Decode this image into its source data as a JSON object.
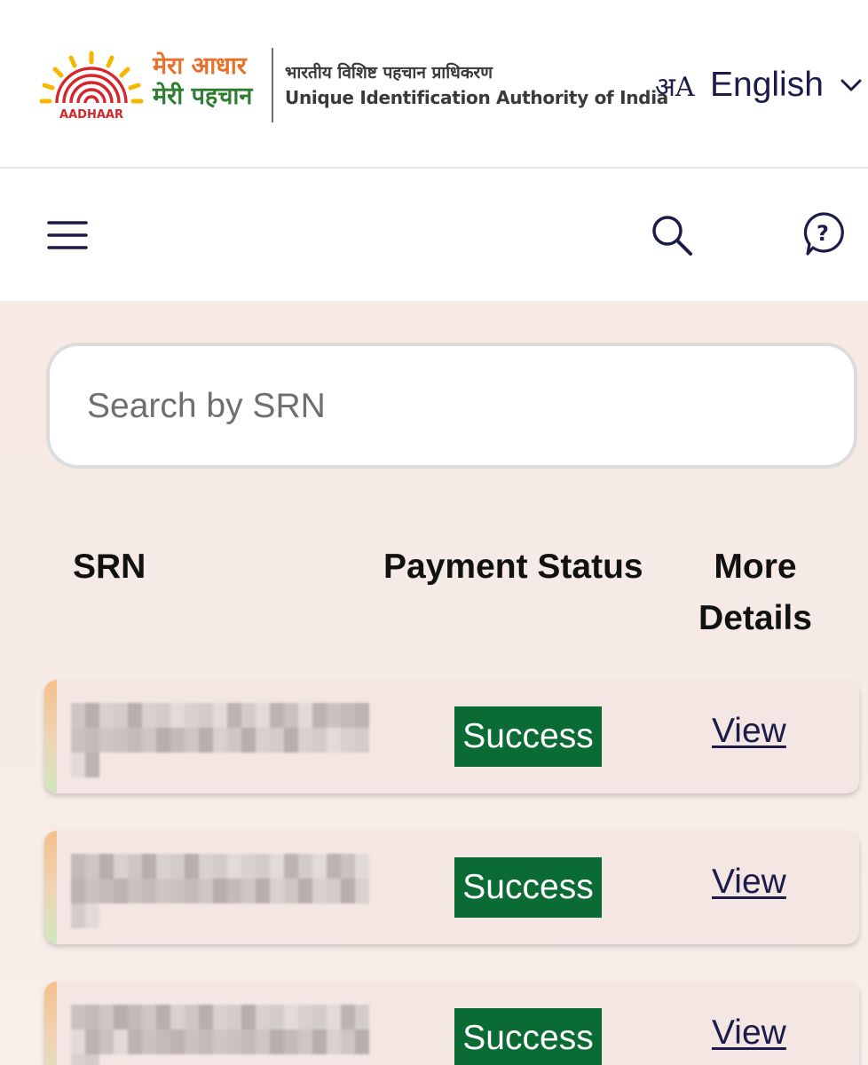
{
  "header": {
    "logo_text": "AADHAAR",
    "tagline_line1": "मेरा आधार",
    "tagline_line2": "मेरी पहचान",
    "org_name_hindi": "भारतीय विशिष्ट पहचान प्राधिकरण",
    "org_name_english": "Unique Identification Authority of India",
    "language_icon_glyph": "अA",
    "language_selected": "English",
    "colors": {
      "saffron": "#e8702a",
      "green": "#2e7d32",
      "navy": "#1c1c4a"
    }
  },
  "navbar": {
    "icons": [
      "menu-icon",
      "search-icon",
      "help-icon"
    ]
  },
  "search": {
    "placeholder": "Search by SRN",
    "value": ""
  },
  "table": {
    "columns": {
      "srn": "SRN",
      "payment_status": "Payment Status",
      "more_details": "More Details"
    },
    "rows": [
      {
        "srn": "",
        "payment_status": "Success",
        "action": "View"
      },
      {
        "srn": "",
        "payment_status": "Success",
        "action": "View"
      },
      {
        "srn": "",
        "payment_status": "Success",
        "action": "View"
      }
    ],
    "status_color": "#0a6b34"
  }
}
